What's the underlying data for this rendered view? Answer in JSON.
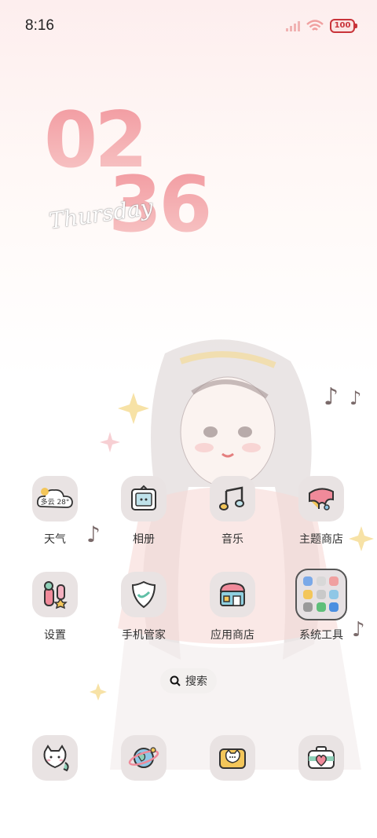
{
  "status_bar": {
    "time": "8:16",
    "battery": "100"
  },
  "clock": {
    "hours": "02",
    "minutes": "36",
    "weekday": "Thursday"
  },
  "apps": [
    {
      "label": "天气",
      "badge_text": "多云 28°",
      "icon": "weather-cloud-icon"
    },
    {
      "label": "相册",
      "icon": "gallery-frame-icon"
    },
    {
      "label": "音乐",
      "icon": "music-note-icon"
    },
    {
      "label": "主题商店",
      "icon": "theme-paint-icon"
    },
    {
      "label": "设置",
      "icon": "settings-tools-icon"
    },
    {
      "label": "手机管家",
      "icon": "security-shield-icon"
    },
    {
      "label": "应用商店",
      "icon": "app-store-shop-icon"
    },
    {
      "label": "系统工具",
      "icon": "folder-icon"
    }
  ],
  "search": {
    "label": "搜索"
  },
  "dock": [
    {
      "icon": "phone-cat-icon"
    },
    {
      "icon": "browser-planet-icon"
    },
    {
      "icon": "messages-cat-icon"
    },
    {
      "icon": "camera-heart-icon"
    }
  ],
  "colors": {
    "clock": "#f29aa0",
    "tile": "#e9e3e3",
    "battery": "#c9343a"
  }
}
